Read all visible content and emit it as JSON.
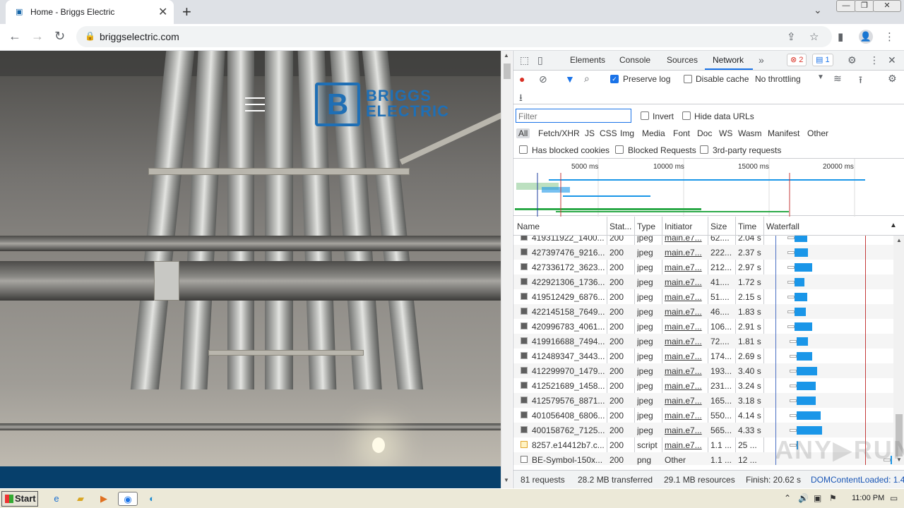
{
  "browser": {
    "tab_title": "Home - Briggs Electric",
    "url": "briggselectric.com"
  },
  "page": {
    "logo_line1": "BRIGGS",
    "logo_line2": "ELECTRIC"
  },
  "devtools": {
    "tabs": [
      "Elements",
      "Console",
      "Sources",
      "Network"
    ],
    "active_tab": "Network",
    "error_count": "2",
    "message_count": "1",
    "preserve_log_label": "Preserve log",
    "disable_cache_label": "Disable cache",
    "throttling": "No throttling",
    "filter_placeholder": "Filter",
    "invert_label": "Invert",
    "hide_data_urls_label": "Hide data URLs",
    "filter_types": [
      "All",
      "Fetch/XHR",
      "JS",
      "CSS",
      "Img",
      "Media",
      "Font",
      "Doc",
      "WS",
      "Wasm",
      "Manifest",
      "Other"
    ],
    "blocked_cookies_label": "Has blocked cookies",
    "blocked_requests_label": "Blocked Requests",
    "third_party_label": "3rd-party requests",
    "timeline_ticks": [
      "5000 ms",
      "10000 ms",
      "15000 ms",
      "20000 ms"
    ],
    "columns": [
      "Name",
      "Stat...",
      "Type",
      "Initiator",
      "Size",
      "Time",
      "Waterfall"
    ],
    "rows": [
      {
        "name": "419311922_1400...",
        "status": "200",
        "type": "jpeg",
        "initiator": "main.e7...",
        "size": "62....",
        "time": "2.04 s",
        "icon": "img",
        "start": 0.22,
        "len": 0.1
      },
      {
        "name": "427397476_9216...",
        "status": "200",
        "type": "jpeg",
        "initiator": "main.e7...",
        "size": "222...",
        "time": "2.37 s",
        "icon": "img",
        "start": 0.22,
        "len": 0.11
      },
      {
        "name": "427336172_3623...",
        "status": "200",
        "type": "jpeg",
        "initiator": "main.e7...",
        "size": "212...",
        "time": "2.97 s",
        "icon": "img",
        "start": 0.22,
        "len": 0.14
      },
      {
        "name": "422921306_1736...",
        "status": "200",
        "type": "jpeg",
        "initiator": "main.e7...",
        "size": "41....",
        "time": "1.72 s",
        "icon": "img",
        "start": 0.22,
        "len": 0.08
      },
      {
        "name": "419512429_6876...",
        "status": "200",
        "type": "jpeg",
        "initiator": "main.e7...",
        "size": "51....",
        "time": "2.15 s",
        "icon": "img",
        "start": 0.22,
        "len": 0.1
      },
      {
        "name": "422145158_7649...",
        "status": "200",
        "type": "jpeg",
        "initiator": "main.e7...",
        "size": "46....",
        "time": "1.83 s",
        "icon": "img",
        "start": 0.22,
        "len": 0.09
      },
      {
        "name": "420996783_4061...",
        "status": "200",
        "type": "jpeg",
        "initiator": "main.e7...",
        "size": "106...",
        "time": "2.91 s",
        "icon": "img",
        "start": 0.22,
        "len": 0.14
      },
      {
        "name": "419916688_7494...",
        "status": "200",
        "type": "jpeg",
        "initiator": "main.e7...",
        "size": "72....",
        "time": "1.81 s",
        "icon": "img",
        "start": 0.24,
        "len": 0.09
      },
      {
        "name": "412489347_3443...",
        "status": "200",
        "type": "jpeg",
        "initiator": "main.e7...",
        "size": "174...",
        "time": "2.69 s",
        "icon": "img",
        "start": 0.24,
        "len": 0.12
      },
      {
        "name": "412299970_1479...",
        "status": "200",
        "type": "jpeg",
        "initiator": "main.e7...",
        "size": "193...",
        "time": "3.40 s",
        "icon": "img",
        "start": 0.24,
        "len": 0.16
      },
      {
        "name": "412521689_1458...",
        "status": "200",
        "type": "jpeg",
        "initiator": "main.e7...",
        "size": "231...",
        "time": "3.24 s",
        "icon": "img",
        "start": 0.24,
        "len": 0.15
      },
      {
        "name": "412579576_8871...",
        "status": "200",
        "type": "jpeg",
        "initiator": "main.e7...",
        "size": "165...",
        "time": "3.18 s",
        "icon": "img",
        "start": 0.24,
        "len": 0.15
      },
      {
        "name": "401056408_6806...",
        "status": "200",
        "type": "jpeg",
        "initiator": "main.e7...",
        "size": "550...",
        "time": "4.14 s",
        "icon": "img",
        "start": 0.24,
        "len": 0.19
      },
      {
        "name": "400158762_7125...",
        "status": "200",
        "type": "jpeg",
        "initiator": "main.e7...",
        "size": "565...",
        "time": "4.33 s",
        "icon": "img",
        "start": 0.24,
        "len": 0.2
      },
      {
        "name": "8257.e14412b7.c...",
        "status": "200",
        "type": "script",
        "initiator": "main.e7...",
        "size": "1.1 ...",
        "time": "25 ...",
        "icon": "js",
        "start": 0.24,
        "len": 0.01
      },
      {
        "name": "BE-Symbol-150x...",
        "status": "200",
        "type": "png",
        "initiator": "Other",
        "size": "1.1 ...",
        "time": "12 ...",
        "icon": "png",
        "start": 0.98,
        "len": 0.01
      }
    ],
    "status_bar": {
      "requests": "81 requests",
      "transferred": "28.2 MB transferred",
      "resources": "29.1 MB resources",
      "finish": "Finish: 20.62 s",
      "dom_content_loaded": "DOMContentLoaded: 1.4"
    }
  },
  "taskbar": {
    "start_label": "Start",
    "clock": "11:00 PM"
  },
  "watermark": "ANY.RUN"
}
